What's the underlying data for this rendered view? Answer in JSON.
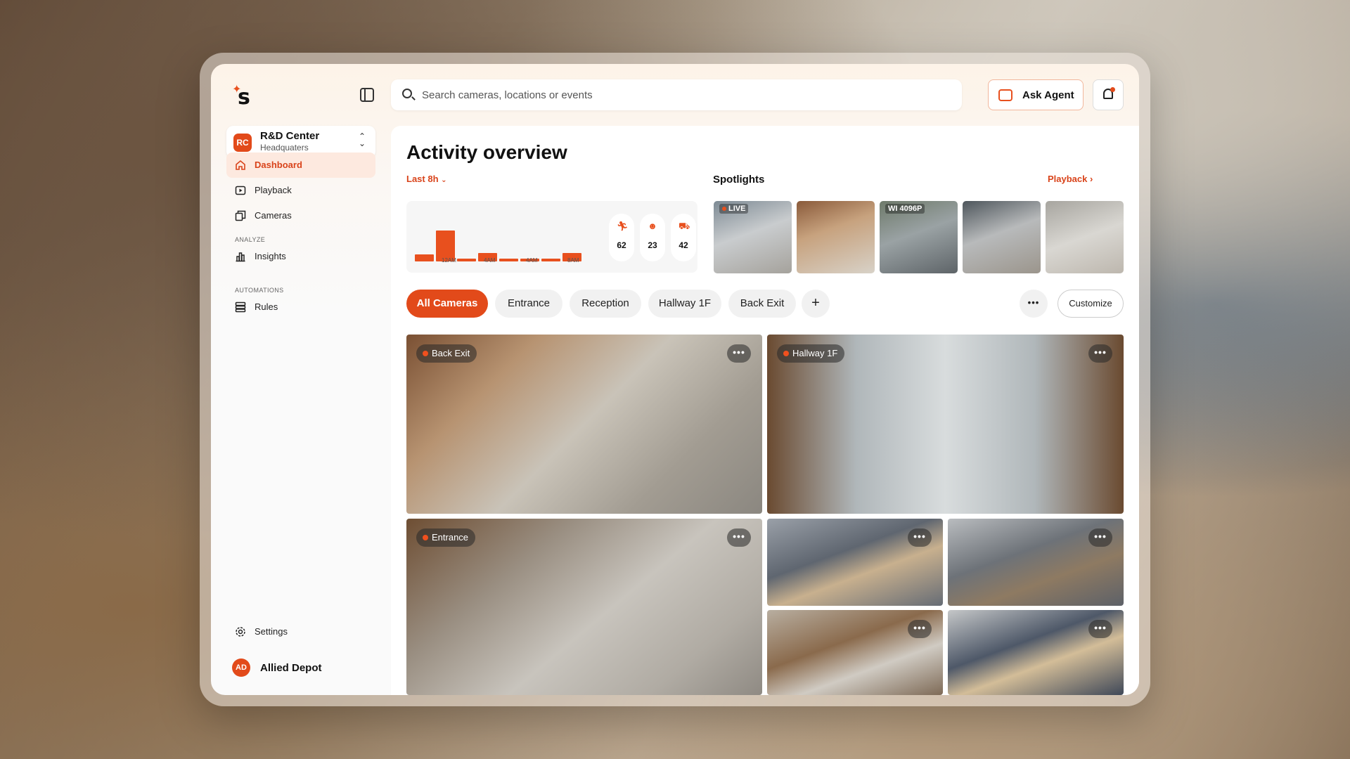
{
  "brand": {
    "logo_letter": "s"
  },
  "workspace": {
    "badge": "RC",
    "name": "R&D Center",
    "subtitle": "Headquaters"
  },
  "nav": {
    "dashboard": "Dashboard",
    "playback": "Playback",
    "cameras": "Cameras",
    "section_analyze": "ANALYZE",
    "insights": "Insights",
    "section_automations": "AUTOMATIONS",
    "rules": "Rules",
    "settings": "Settings"
  },
  "user": {
    "initials": "AD",
    "name": "Allied Depot"
  },
  "search": {
    "placeholder": "Search cameras, locations or events"
  },
  "header": {
    "ask_agent": "Ask Agent"
  },
  "main": {
    "title": "Activity overview",
    "range": "Last 8h",
    "spotlights_title": "Spotlights",
    "playback_link": "Playback"
  },
  "activity": {
    "bars": [
      0.22,
      1.0,
      0.1,
      0.27,
      0.1,
      0.1,
      0.1,
      0.27
    ],
    "ticks": [
      "12AM",
      "4AM",
      "4AM",
      "8AM"
    ],
    "metrics": [
      {
        "icon": "person-walking-icon",
        "value": "62"
      },
      {
        "icon": "face-icon",
        "value": "23"
      },
      {
        "icon": "car-icon",
        "value": "42"
      }
    ],
    "accent": "#e8501e"
  },
  "spotlights": [
    {
      "tag": "LIVE"
    },
    {
      "tag": ""
    },
    {
      "tag": "WI 4096P"
    },
    {
      "tag": ""
    },
    {
      "tag": ""
    }
  ],
  "filters": {
    "chips": [
      "All Cameras",
      "Entrance",
      "Reception",
      "Hallway 1F",
      "Back Exit"
    ],
    "add": "+",
    "more": "•••",
    "customize": "Customize"
  },
  "cameras": [
    {
      "label": "Back Exit",
      "more": "•••"
    },
    {
      "label": "Hallway 1F",
      "more": "•••"
    },
    {
      "label": "Entrance",
      "more": "•••"
    },
    {
      "label": "",
      "more": "•••"
    },
    {
      "label": "",
      "more": "•••"
    },
    {
      "label": "",
      "more": "•••"
    },
    {
      "label": "",
      "more": "•••"
    }
  ]
}
